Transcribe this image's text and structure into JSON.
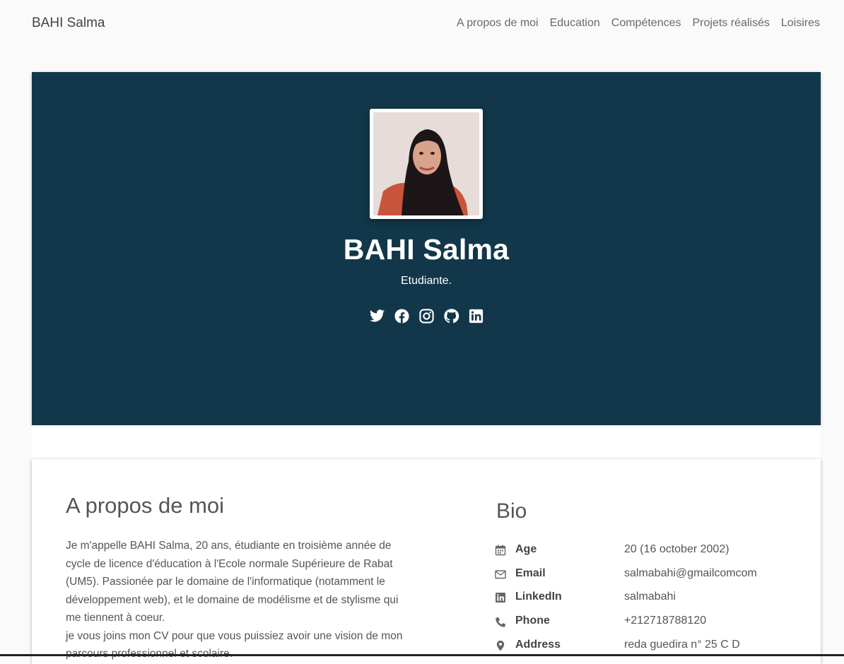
{
  "nav": {
    "brand": "BAHI Salma",
    "items": [
      {
        "label": "A propos de moi"
      },
      {
        "label": "Education"
      },
      {
        "label": "Compétences"
      },
      {
        "label": "Projets réalisés"
      },
      {
        "label": "Loisires"
      }
    ]
  },
  "hero": {
    "name": "BAHI Salma",
    "role": "Etudiante.",
    "social": [
      "twitter-icon",
      "facebook-icon",
      "instagram-icon",
      "github-icon",
      "linkedin-icon"
    ],
    "bg_color": "#12374a"
  },
  "about": {
    "title": "A propos de moi",
    "paragraph1": "Je m'appelle BAHI Salma, 20 ans, étudiante en troisième année de cycle de licence d'éducation à l'Ecole normale Supérieure de Rabat (UM5). Passionée par le domaine de l'informatique (notamment le développement web), et le domaine de modélisme et de stylisme qui me tiennent à coeur.",
    "paragraph2": "je vous joins mon CV pour que vous puissiez avoir une vision de mon parcours professionnel et scolaire."
  },
  "bio": {
    "title": "Bio",
    "rows": [
      {
        "icon": "calendar-icon",
        "label": "Age",
        "value": "20 (16 october 2002)"
      },
      {
        "icon": "envelope-icon",
        "label": "Email",
        "value": "salmabahi@gmailcomcom"
      },
      {
        "icon": "linkedin-icon",
        "label": "LinkedIn",
        "value": "salmabahi"
      },
      {
        "icon": "phone-icon",
        "label": "Phone",
        "value": "+212718788120"
      },
      {
        "icon": "map-marker-icon",
        "label": "Address",
        "value": "reda guedira n° 25 C D"
      }
    ]
  }
}
